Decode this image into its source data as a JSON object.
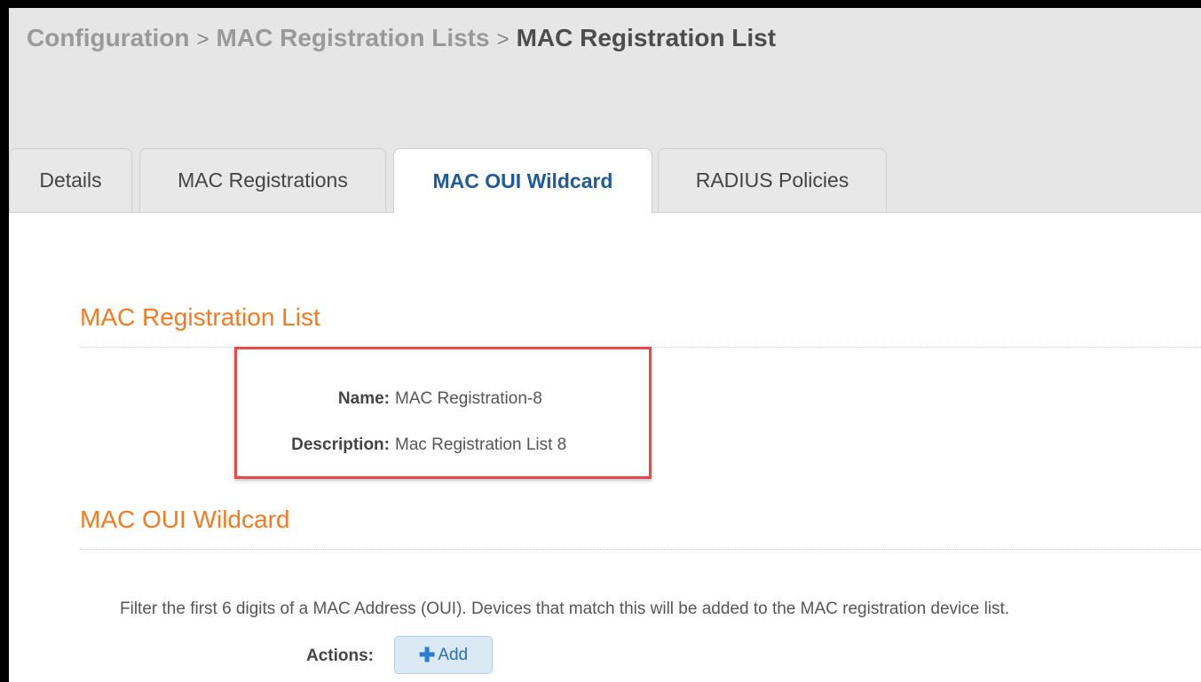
{
  "breadcrumb": {
    "items": [
      "Configuration",
      "MAC Registration Lists"
    ],
    "separator": ">",
    "current": "MAC Registration List"
  },
  "tabs": [
    {
      "label": "Details",
      "active": false
    },
    {
      "label": "MAC Registrations",
      "active": false
    },
    {
      "label": "MAC OUI Wildcard",
      "active": true
    },
    {
      "label": "RADIUS Policies",
      "active": false
    }
  ],
  "list_section": {
    "title": "MAC Registration List",
    "name_label": "Name:",
    "name_value": "MAC Registration-8",
    "description_label": "Description:",
    "description_value": "Mac Registration List 8"
  },
  "wildcard_section": {
    "title": "MAC OUI Wildcard",
    "help_text": "Filter the first 6 digits of a MAC Address (OUI). Devices that match this will be added to the MAC registration device list.",
    "actions_label": "Actions:",
    "add_label": "Add",
    "add_icon": "plus-icon"
  },
  "colors": {
    "accent_orange": "#f47a20",
    "active_tab": "#1f5a99",
    "highlight_border": "#e8484a",
    "button_bg": "#dbe9f5"
  }
}
